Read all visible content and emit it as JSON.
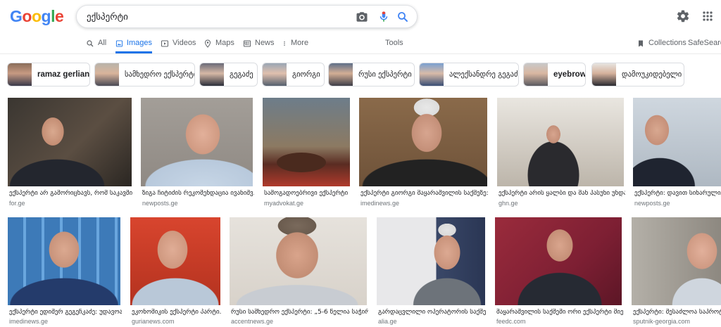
{
  "search": {
    "query": "ექსპერტი"
  },
  "logo": {
    "letters": [
      "G",
      "o",
      "o",
      "g",
      "l",
      "e"
    ],
    "colors": [
      "#4285F4",
      "#EA4335",
      "#FBBC05",
      "#4285F4",
      "#34A853",
      "#EA4335"
    ]
  },
  "header": {
    "settings_icon": "gear-icon",
    "apps_icon": "apps-grid-icon"
  },
  "tabs": [
    {
      "label": "All",
      "icon": "search-icon"
    },
    {
      "label": "Images",
      "icon": "image-icon",
      "active": true
    },
    {
      "label": "Videos",
      "icon": "play-icon"
    },
    {
      "label": "Maps",
      "icon": "map-pin-icon"
    },
    {
      "label": "News",
      "icon": "news-icon"
    },
    {
      "label": "More",
      "icon": "more-vert-icon"
    }
  ],
  "tools": {
    "label": "Tools"
  },
  "right_links": {
    "collections": "Collections",
    "safesearch": "SafeSearch"
  },
  "chips": [
    {
      "label": "ramaz gerliani",
      "bold": true
    },
    {
      "label": "სამხედრო ექსპერტი",
      "bold": false
    },
    {
      "label": "გეგაძე",
      "bold": false
    },
    {
      "label": "გიორგი",
      "bold": false
    },
    {
      "label": "რუსი ექსპერტი",
      "bold": false
    },
    {
      "label": "ალექსანდრე გეგაძე",
      "bold": false
    },
    {
      "label": "eyebrow",
      "bold": true
    },
    {
      "label": "დამოუკიდებელი",
      "bold": false
    }
  ],
  "results_row1": [
    {
      "title": "ექსპერტი არ გამორიცხავს, რომ საკავში...",
      "source": "for.ge"
    },
    {
      "title": "ზიგა ჩიტიძის რეკომენდაცია ივანიშვ...",
      "source": "newposts.ge"
    },
    {
      "title": "სამოგადოებრივი ექსპერტი",
      "source": "myadvokat.ge"
    },
    {
      "title": "ექსპერტი გიორგი მაყარაშვილის საქმეზე: ...",
      "source": "imedinews.ge"
    },
    {
      "title": "ექსპერტი არის ყალბი და მან პასუხი უნდა...",
      "source": "ghn.ge"
    },
    {
      "title": "ექსპერტი: დავით სიხარულიძე...",
      "source": "newposts.ge"
    }
  ],
  "results_row2": [
    {
      "title": "ექსპერტი ედიშერ გეგეჩკაძე: უდავოა...",
      "source": "imedinews.ge"
    },
    {
      "title": "ეკონომიკის ექსპერტი პარტი...",
      "source": "gurianews.com"
    },
    {
      "title": "რუსი სამხედრო ექსპერტი: „5-6 წელია საჭირ...",
      "source": "accentnews.ge"
    },
    {
      "title": "გარდაცვლილი ოპერატორის საქმე...",
      "source": "alia.ge"
    },
    {
      "title": "მაყარაშვილის საქმეში ორი ექსპერტი მიერ...",
      "source": "feedc.com"
    },
    {
      "title": "ექსპერტი: შესაძლოა საპროტესტო...",
      "source": "sputnik-georgia.com"
    }
  ],
  "colors": {
    "accent": "#1a73e8",
    "mic_blue": "#4285F4",
    "mic_red": "#EA4335"
  }
}
